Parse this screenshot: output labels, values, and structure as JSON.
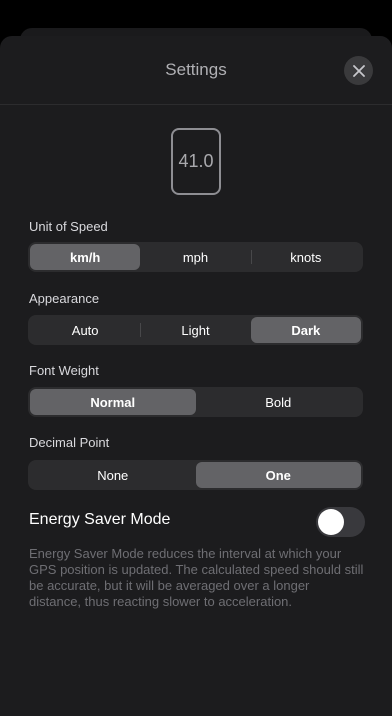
{
  "header": {
    "title": "Settings"
  },
  "preview": {
    "value": "41.0"
  },
  "unit_of_speed": {
    "label": "Unit of Speed",
    "options": [
      "km/h",
      "mph",
      "knots"
    ],
    "selected": "km/h"
  },
  "appearance": {
    "label": "Appearance",
    "options": [
      "Auto",
      "Light",
      "Dark"
    ],
    "selected": "Dark"
  },
  "font_weight": {
    "label": "Font Weight",
    "options": [
      "Normal",
      "Bold"
    ],
    "selected": "Normal"
  },
  "decimal_point": {
    "label": "Decimal Point",
    "options": [
      "None",
      "One"
    ],
    "selected": "One"
  },
  "energy_saver": {
    "label": "Energy Saver Mode",
    "enabled": false,
    "description": "Energy Saver Mode reduces the interval at which your GPS position is updated. The calculated speed should still be accurate, but it will be averaged over a longer distance, thus reacting slower to acceleration."
  },
  "icons": {
    "close": "close-icon"
  },
  "colors": {
    "background": "#1c1c1e",
    "segment_bg": "#2c2c2e",
    "segment_selected": "#636366",
    "text_primary": "#ffffff",
    "text_secondary": "#6e6e73"
  }
}
